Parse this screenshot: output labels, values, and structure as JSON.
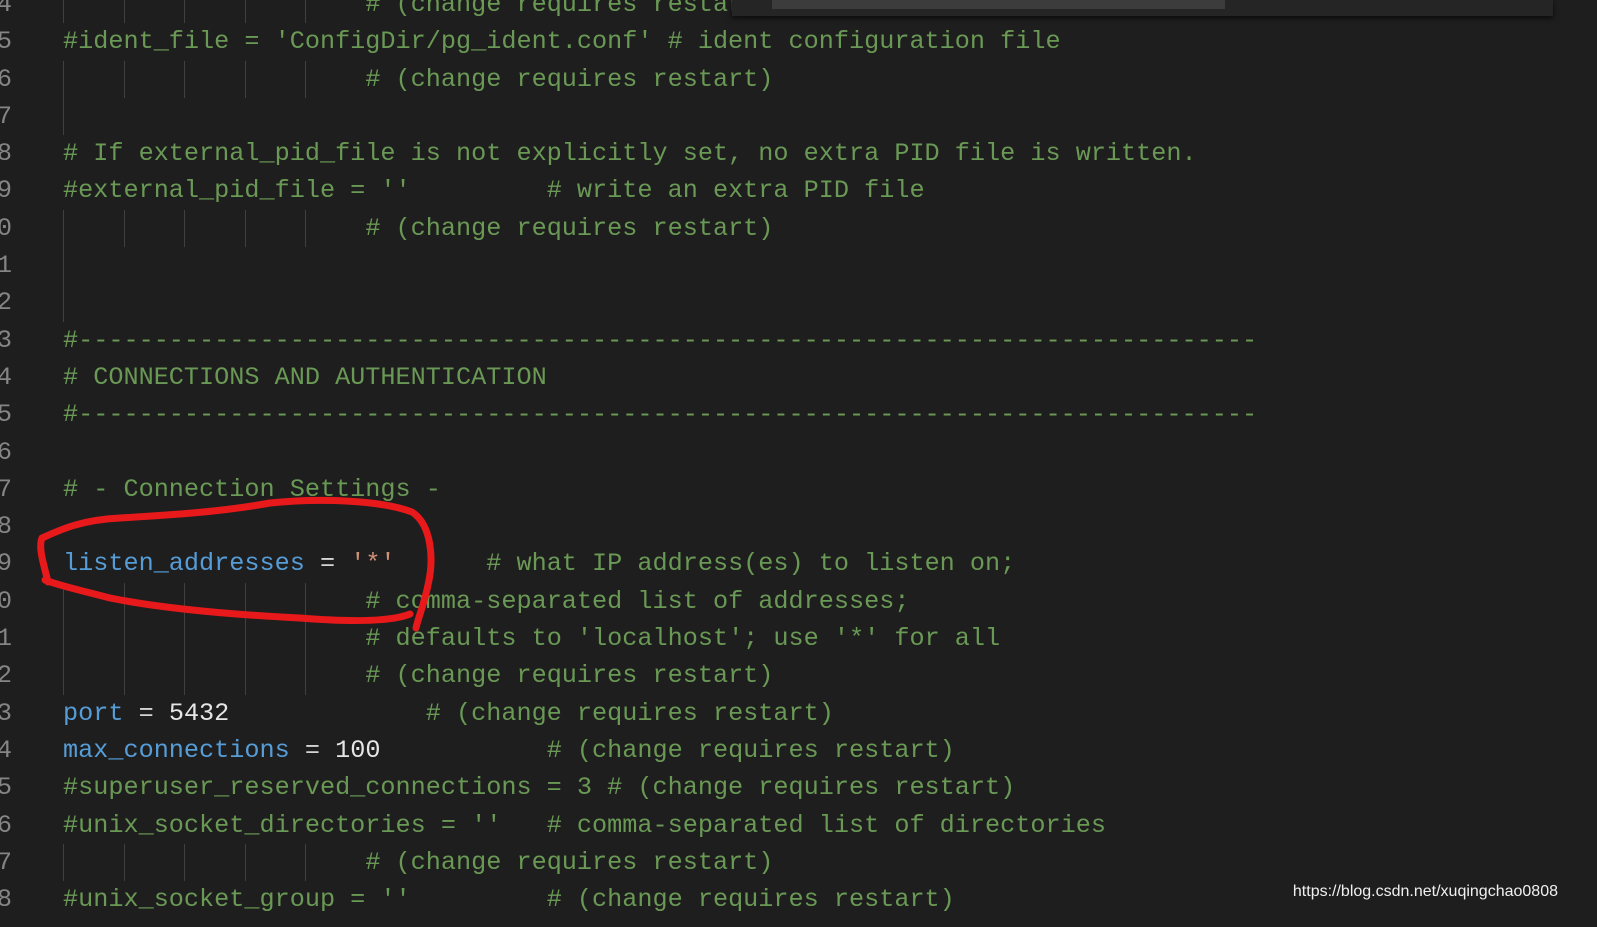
{
  "colors": {
    "background": "#1e1e1e",
    "comment": "#6a9955",
    "key": "#569cd6",
    "string": "#ce9178",
    "annotation": "#e8191b"
  },
  "lines": [
    {
      "number": "4",
      "guides": 5,
      "tokens": [
        {
          "t": "\t\t\t\t\t# (change requires restart)",
          "c": "c"
        }
      ]
    },
    {
      "number": "5",
      "guides": 0,
      "tokens": [
        {
          "t": "#ident_file = 'ConfigDir/pg_ident.conf' # ident configuration file",
          "c": "c"
        }
      ]
    },
    {
      "number": "6",
      "guides": 5,
      "tokens": [
        {
          "t": "\t\t\t\t\t# (change requires restart)",
          "c": "c"
        }
      ]
    },
    {
      "number": "7",
      "guides": 1,
      "tokens": []
    },
    {
      "number": "8",
      "guides": 0,
      "tokens": [
        {
          "t": "# If external_pid_file is not explicitly set, no extra PID file is written.",
          "c": "c"
        }
      ]
    },
    {
      "number": "9",
      "guides": 0,
      "tokens": [
        {
          "t": "#external_pid_file = ''\t\t\t# write an extra PID file",
          "c": "c"
        }
      ]
    },
    {
      "number": "0",
      "guides": 5,
      "tokens": [
        {
          "t": "\t\t\t\t\t# (change requires restart)",
          "c": "c"
        }
      ]
    },
    {
      "number": "1",
      "guides": 1,
      "tokens": []
    },
    {
      "number": "2",
      "guides": 1,
      "tokens": []
    },
    {
      "number": "3",
      "guides": 0,
      "tokens": [
        {
          "t": "#------------------------------------------------------------------------------",
          "c": "c"
        }
      ]
    },
    {
      "number": "4",
      "guides": 0,
      "tokens": [
        {
          "t": "# CONNECTIONS AND AUTHENTICATION",
          "c": "c"
        }
      ]
    },
    {
      "number": "5",
      "guides": 0,
      "tokens": [
        {
          "t": "#------------------------------------------------------------------------------",
          "c": "c"
        }
      ]
    },
    {
      "number": "6",
      "guides": 0,
      "tokens": []
    },
    {
      "number": "7",
      "guides": 0,
      "tokens": [
        {
          "t": "# - Connection Settings -",
          "c": "c"
        }
      ]
    },
    {
      "number": "8",
      "guides": 0,
      "tokens": []
    },
    {
      "number": "9",
      "guides": 0,
      "tokens": [
        {
          "t": "listen_addresses",
          "c": "k"
        },
        {
          "t": " = ",
          "c": "o"
        },
        {
          "t": "'*'",
          "c": "s"
        },
        {
          "t": "\t\t# what IP address(es) to listen on;",
          "c": "c"
        }
      ]
    },
    {
      "number": "0",
      "guides": 5,
      "tokens": [
        {
          "t": "\t\t\t\t\t# comma-separated list of addresses;",
          "c": "c"
        }
      ]
    },
    {
      "number": "1",
      "guides": 5,
      "tokens": [
        {
          "t": "\t\t\t\t\t# defaults to 'localhost'; use '*' for all",
          "c": "c"
        }
      ]
    },
    {
      "number": "2",
      "guides": 5,
      "tokens": [
        {
          "t": "\t\t\t\t\t# (change requires restart)",
          "c": "c"
        }
      ]
    },
    {
      "number": "3",
      "guides": 0,
      "tokens": [
        {
          "t": "port",
          "c": "k"
        },
        {
          "t": " = ",
          "c": "o"
        },
        {
          "t": "5432",
          "c": "n"
        },
        {
          "t": "\t\t\t\t# (change requires restart)",
          "c": "c"
        }
      ]
    },
    {
      "number": "4",
      "guides": 0,
      "tokens": [
        {
          "t": "max_connections",
          "c": "k"
        },
        {
          "t": " = ",
          "c": "o"
        },
        {
          "t": "100",
          "c": "n"
        },
        {
          "t": "\t\t\t# (change requires restart)",
          "c": "c"
        }
      ]
    },
    {
      "number": "5",
      "guides": 0,
      "tokens": [
        {
          "t": "#superuser_reserved_connections = 3 # (change requires restart)",
          "c": "c"
        }
      ]
    },
    {
      "number": "6",
      "guides": 0,
      "tokens": [
        {
          "t": "#unix_socket_directories = ''\t# comma-separated list of directories",
          "c": "c"
        }
      ]
    },
    {
      "number": "7",
      "guides": 5,
      "tokens": [
        {
          "t": "\t\t\t\t\t# (change requires restart)",
          "c": "c"
        }
      ]
    },
    {
      "number": "8",
      "guides": 0,
      "tokens": [
        {
          "t": "#unix_socket_group = ''\t\t\t# (change requires restart)",
          "c": "c"
        }
      ]
    }
  ],
  "watermark": "https://blog.csdn.net/xuqingchao0808"
}
